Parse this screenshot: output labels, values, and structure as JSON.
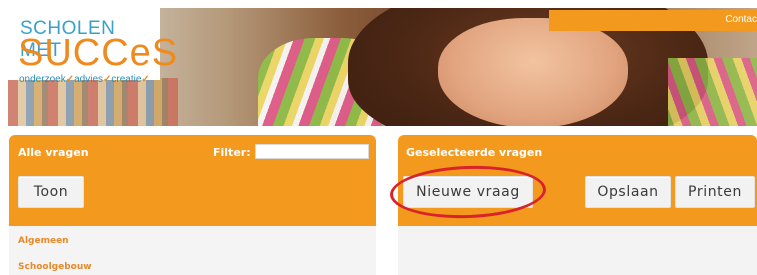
{
  "header": {
    "logo": {
      "line1": "SCHOLEN MET",
      "line2": "SUCCeS",
      "tagline": [
        "onderzoek",
        "advies",
        "creatie"
      ]
    },
    "contact_label": "Contac"
  },
  "left_panel": {
    "title": "Alle vragen",
    "filter_label": "Filter:",
    "filter_value": "",
    "toon_label": "Toon",
    "categories": [
      "Algemeen",
      "Schoolgebouw"
    ]
  },
  "right_panel": {
    "title": "Geselecteerde vragen",
    "new_question_label": "Nieuwe vraag",
    "save_label": "Opslaan",
    "print_label": "Printen"
  },
  "colors": {
    "accent": "#f39a1e",
    "highlight": "#d8232a",
    "category_text": "#e8892a"
  }
}
